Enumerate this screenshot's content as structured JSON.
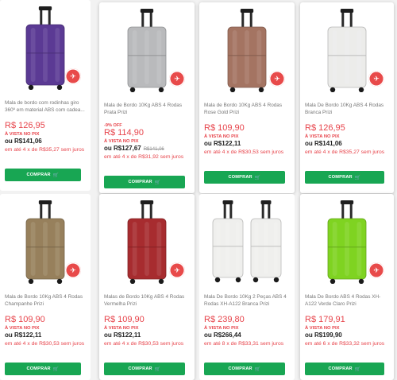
{
  "products": [
    {
      "title": "Mala de bordo com rodinhas giro 360º em material ABS com cadea...",
      "discount": "",
      "price": "R$ 126,95",
      "pix_label": "À VISTA NO PIX",
      "pix_prefix": "ou",
      "pix_price": "R$141,06",
      "pix_old": "",
      "installments": "em até 4 x de R$35,27 sem juros",
      "button": "COMPRAR",
      "color": "#5b3a94",
      "badge": true
    },
    {
      "title": "Mala de Bordo 10Kg ABS 4 Rodas Prata Prizi",
      "discount": "-9% OFF",
      "price": "R$ 114,90",
      "pix_label": "À VISTA NO PIX",
      "pix_prefix": "ou",
      "pix_price": "R$127,67",
      "pix_old": "R$141,06",
      "installments": "em até 4 x de R$31,92 sem juros",
      "button": "COMPRAR",
      "color": "#b9babc",
      "badge": true
    },
    {
      "title": "Mala de Bordo 10Kg ABS 4 Rodas Rose Gold Prizi",
      "discount": "",
      "price": "R$ 109,90",
      "pix_label": "À VISTA NO PIX",
      "pix_prefix": "ou",
      "pix_price": "R$122,11",
      "pix_old": "",
      "installments": "em até 4 x de R$30,53 sem juros",
      "button": "COMPRAR",
      "color": "#a47462",
      "badge": true
    },
    {
      "title": "Mala De Bordo 10Kg ABS 4 Rodas Branca Prizi",
      "discount": "",
      "price": "R$ 126,95",
      "pix_label": "À VISTA NO PIX",
      "pix_prefix": "ou",
      "pix_price": "R$141,06",
      "pix_old": "",
      "installments": "em até 4 x de R$35,27 sem juros",
      "button": "COMPRAR",
      "color": "#ececea",
      "badge": true
    },
    {
      "title": "Mala de Bordo 10Kg ABS 4 Rodas Champanhe Prizi",
      "discount": "",
      "price": "R$ 109,90",
      "pix_label": "À VISTA NO PIX",
      "pix_prefix": "ou",
      "pix_price": "R$122,11",
      "pix_old": "",
      "installments": "em até 4 x de R$30,53 sem juros",
      "button": "COMPRAR",
      "color": "#97805c",
      "badge": true
    },
    {
      "title": "Malas de Bordo 10Kg ABS 4 Rodas Vermelha Prizi",
      "discount": "",
      "price": "R$ 109,90",
      "pix_label": "À VISTA NO PIX",
      "pix_prefix": "ou",
      "pix_price": "R$122,11",
      "pix_old": "",
      "installments": "em até 4 x de R$30,53 sem juros",
      "button": "COMPRAR",
      "color": "#a72c2f",
      "badge": true
    },
    {
      "title": "Mala De Bordo 10Kg 2 Peças ABS 4 Rodas XH-A122 Branca Prizi",
      "discount": "",
      "price": "R$ 239,80",
      "pix_label": "À VISTA NO PIX",
      "pix_prefix": "ou",
      "pix_price": "R$266,44",
      "pix_old": "",
      "installments": "em até 8 x de R$33,31 sem juros",
      "button": "COMPRAR",
      "color": "#efefed",
      "badge": false
    },
    {
      "title": "Mala De Bordo ABS 4 Rodas XH-A122 Verde Claro Prizi",
      "discount": "",
      "price": "R$ 179,91",
      "pix_label": "À VISTA NO PIX",
      "pix_prefix": "ou",
      "pix_price": "R$199,90",
      "pix_old": "",
      "installments": "em até 6 x de R$33,32 sem juros",
      "button": "COMPRAR",
      "color": "#7fd321",
      "badge": true
    }
  ]
}
